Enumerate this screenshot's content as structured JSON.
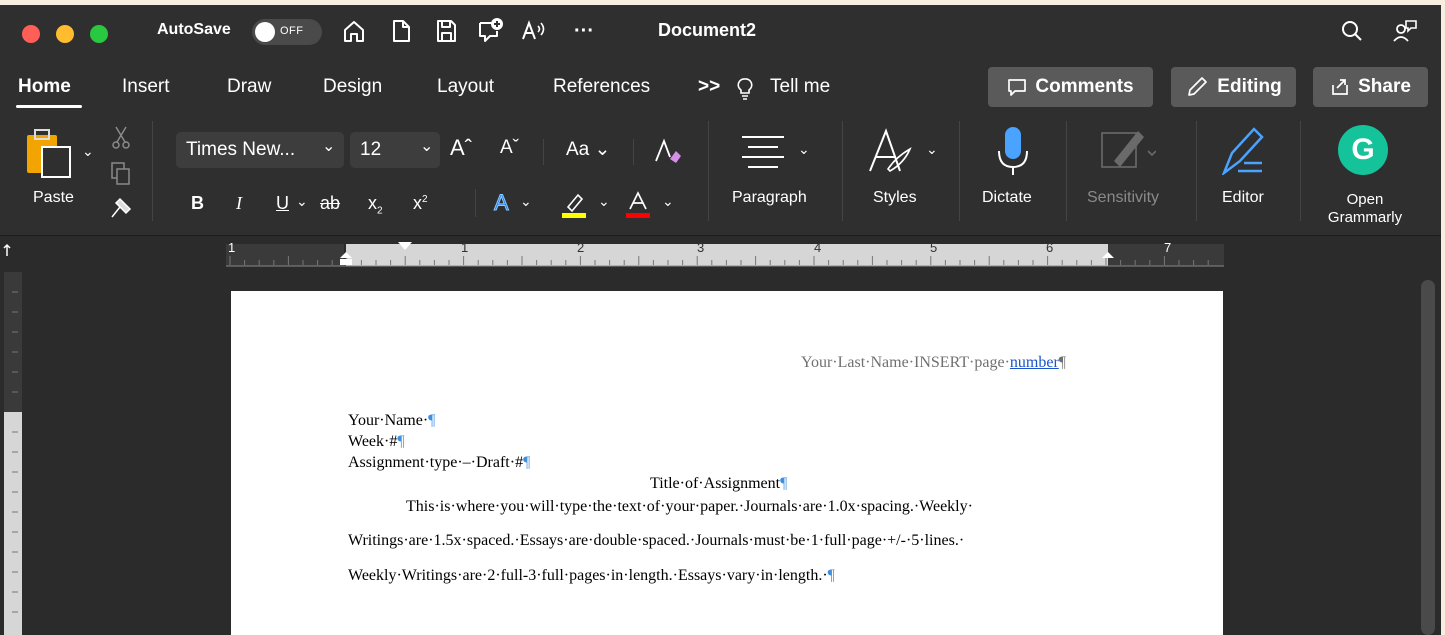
{
  "window": {
    "autosave_label": "AutoSave",
    "autosave_state": "OFF",
    "document_title": "Document2",
    "traffic_colors": [
      "#ff5f57",
      "#febc2e",
      "#28c840"
    ]
  },
  "tabs": {
    "items": [
      "Home",
      "Insert",
      "Draw",
      "Design",
      "Layout",
      "References"
    ],
    "active": "Home",
    "tell_me": "Tell me",
    "more_chevron": ">>"
  },
  "ribbon_buttons": {
    "comments": "Comments",
    "editing": "Editing",
    "share": "Share"
  },
  "ribbon": {
    "paste_label": "Paste",
    "font_name": "Times New...",
    "font_size": "12",
    "change_case": "Aa",
    "bold": "B",
    "italic": "I",
    "underline": "U",
    "strike": "ab",
    "subscript": "x",
    "superscript": "x",
    "paragraph_label": "Paragraph",
    "styles_label": "Styles",
    "dictate_label": "Dictate",
    "sensitivity_label": "Sensitivity",
    "editor_label": "Editor",
    "grammarly_line1": "Open",
    "grammarly_line2": "Grammarly",
    "grammarly_letter": "G",
    "colors": {
      "highlight": "#ffff00",
      "font_color": "#ff0000",
      "grammarly": "#15c39a",
      "dictate": "#4aa3ff",
      "editor": "#4aa3ff"
    }
  },
  "ruler": {
    "numbers": [
      "1",
      "1",
      "2",
      "3",
      "4",
      "5",
      "6",
      "7"
    ]
  },
  "document": {
    "header": "Your·Last·Name·INSERT·page·",
    "header_link": "number",
    "pilcrow": "¶",
    "lines": [
      {
        "text": "Your·Name·",
        "mark": "¶"
      },
      {
        "text": "Week·#",
        "mark": "¶"
      },
      {
        "text": "Assignment·type·–·Draft·#",
        "mark": "¶"
      }
    ],
    "title": "Title·of·Assignment",
    "body": [
      "This·is·where·you·will·type·the·text·of·your·paper.·Journals·are·1.0x·spacing.·Weekly·",
      "Writings·are·1.5x·spaced.·Essays·are·double·spaced.·Journals·must·be·1·full·page·+/-·5·lines.·",
      "Weekly·Writings·are·2·full-3·full·pages·in·length.·Essays·vary·in·length.·"
    ]
  }
}
